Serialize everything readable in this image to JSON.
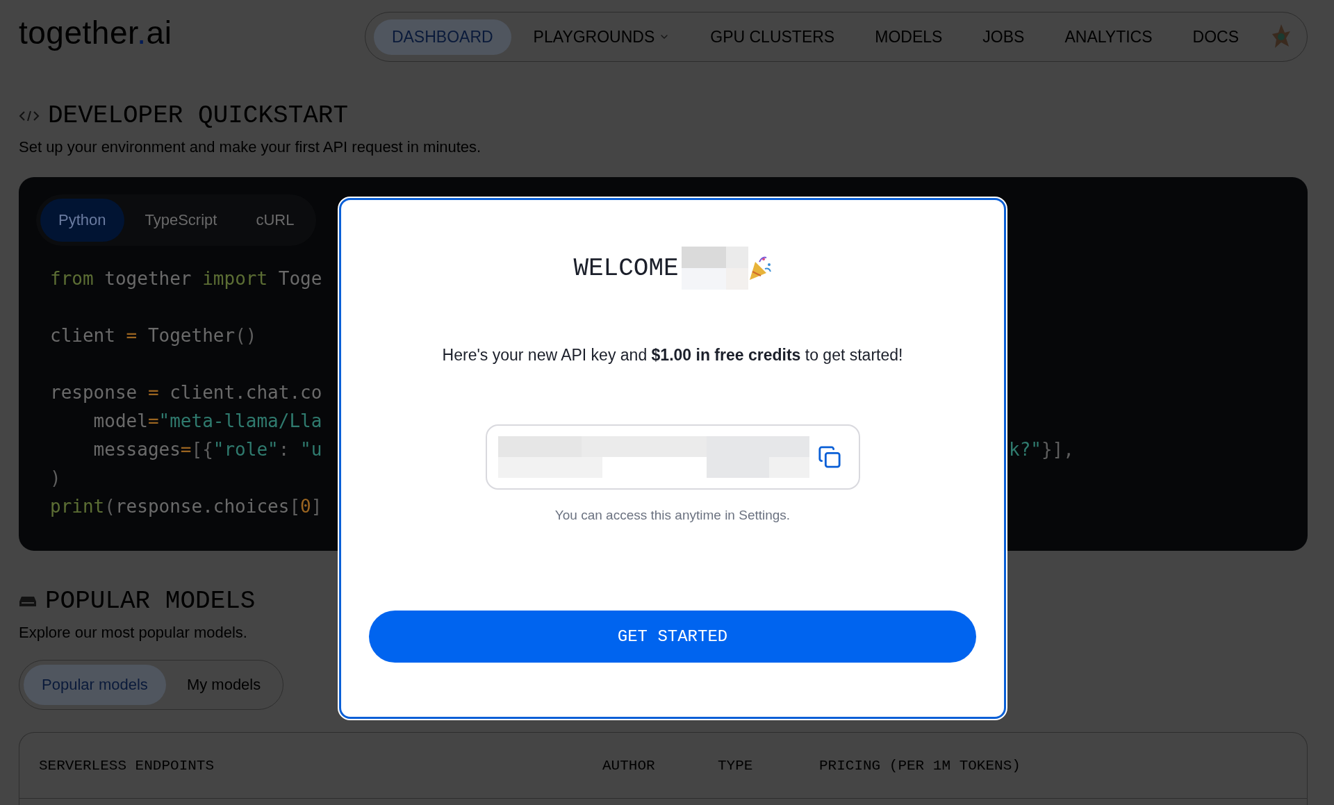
{
  "header": {
    "logo": {
      "before": "together",
      "accent": ".",
      "after": "ai"
    },
    "nav": [
      {
        "label": "DASHBOARD",
        "selected": true,
        "kind": "link"
      },
      {
        "label": "PLAYGROUNDS",
        "selected": false,
        "kind": "dropdown"
      },
      {
        "label": "GPU CLUSTERS",
        "selected": false,
        "kind": "link"
      },
      {
        "label": "MODELS",
        "selected": false,
        "kind": "link"
      },
      {
        "label": "JOBS",
        "selected": false,
        "kind": "link"
      },
      {
        "label": "ANALYTICS",
        "selected": false,
        "kind": "link"
      },
      {
        "label": "DOCS",
        "selected": false,
        "kind": "link"
      }
    ]
  },
  "quickstart": {
    "title": "DEVELOPER QUICKSTART",
    "subtitle": "Set up your environment and make your first API request in minutes.",
    "tabs": [
      {
        "label": "Python",
        "selected": true
      },
      {
        "label": "TypeScript",
        "selected": false
      },
      {
        "label": "cURL",
        "selected": false
      }
    ],
    "code_lines": [
      {
        "kind": "code",
        "left": [
          {
            "kind": "kw",
            "text": "from"
          },
          {
            "kind": "plain",
            "text": " together "
          },
          {
            "kind": "kw",
            "text": "import"
          },
          {
            "kind": "plain",
            "text": " Toge"
          }
        ]
      },
      {
        "kind": "blank"
      },
      {
        "kind": "code",
        "left": [
          {
            "kind": "plain",
            "text": "client "
          },
          {
            "kind": "op",
            "text": "="
          },
          {
            "kind": "plain",
            "text": " Together"
          },
          {
            "kind": "punct",
            "text": "()"
          }
        ]
      },
      {
        "kind": "blank"
      },
      {
        "kind": "code",
        "left": [
          {
            "kind": "plain",
            "text": "response "
          },
          {
            "kind": "op",
            "text": "="
          },
          {
            "kind": "plain",
            "text": " client.chat.co"
          }
        ]
      },
      {
        "kind": "code",
        "left": [
          {
            "kind": "plain",
            "text": "    model"
          },
          {
            "kind": "op",
            "text": "="
          },
          {
            "kind": "str",
            "text": "\"meta-llama/Lla"
          }
        ]
      },
      {
        "kind": "code",
        "left": [
          {
            "kind": "plain",
            "text": "    messages"
          },
          {
            "kind": "op",
            "text": "="
          },
          {
            "kind": "punct",
            "text": "[{"
          },
          {
            "kind": "str",
            "text": "\"role\""
          },
          {
            "kind": "punct",
            "text": ": "
          },
          {
            "kind": "str",
            "text": "\"u"
          }
        ],
        "right": [
          {
            "kind": "str",
            "text": "k?\""
          },
          {
            "kind": "punct",
            "text": "}],"
          }
        ]
      },
      {
        "kind": "code",
        "left": [
          {
            "kind": "punct",
            "text": ")"
          }
        ]
      },
      {
        "kind": "code",
        "left": [
          {
            "kind": "kw",
            "text": "print"
          },
          {
            "kind": "punct",
            "text": "("
          },
          {
            "kind": "plain",
            "text": "response.choices"
          },
          {
            "kind": "punct",
            "text": "["
          },
          {
            "kind": "num",
            "text": "0"
          },
          {
            "kind": "punct",
            "text": "]"
          }
        ]
      }
    ]
  },
  "popular_models": {
    "title": "POPULAR MODELS",
    "subtitle": "Explore our most popular models.",
    "tabs": [
      {
        "label": "Popular models",
        "selected": true
      },
      {
        "label": "My models",
        "selected": false
      }
    ],
    "table": {
      "columns": [
        "SERVERLESS ENDPOINTS",
        "AUTHOR",
        "TYPE",
        "PRICING (PER 1M TOKENS)"
      ]
    }
  },
  "modal": {
    "title": "WELCOME",
    "message": "Here's your new API key and **$1.00 in free credits** to get started!",
    "hint": "You can access this anytime in Settings.",
    "button": "GET STARTED"
  }
}
